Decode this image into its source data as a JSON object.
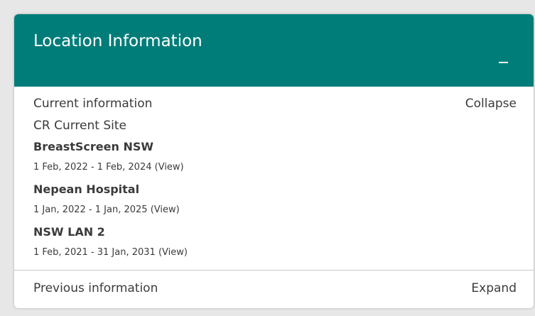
{
  "colors": {
    "header_bg": "#007d79",
    "header_text": "#ffffff",
    "body_text": "#3b3b3b",
    "page_bg": "#e7e7e7"
  },
  "panel": {
    "title": "Location Information",
    "toggle_icon": "minus-icon"
  },
  "current": {
    "label": "Current information",
    "collapse_label": "Collapse",
    "site_label": "CR Current Site",
    "entries": [
      {
        "name": "BreastScreen NSW",
        "dates": "1 Feb, 2022 - 1 Feb, 2024",
        "view": "(View)"
      },
      {
        "name": "Nepean Hospital",
        "dates": "1 Jan, 2022 - 1 Jan, 2025",
        "view": "(View)"
      },
      {
        "name": "NSW LAN 2",
        "dates": "1 Feb, 2021 - 31 Jan, 2031",
        "view": "(View)"
      }
    ]
  },
  "previous": {
    "label": "Previous information",
    "expand_label": "Expand"
  }
}
